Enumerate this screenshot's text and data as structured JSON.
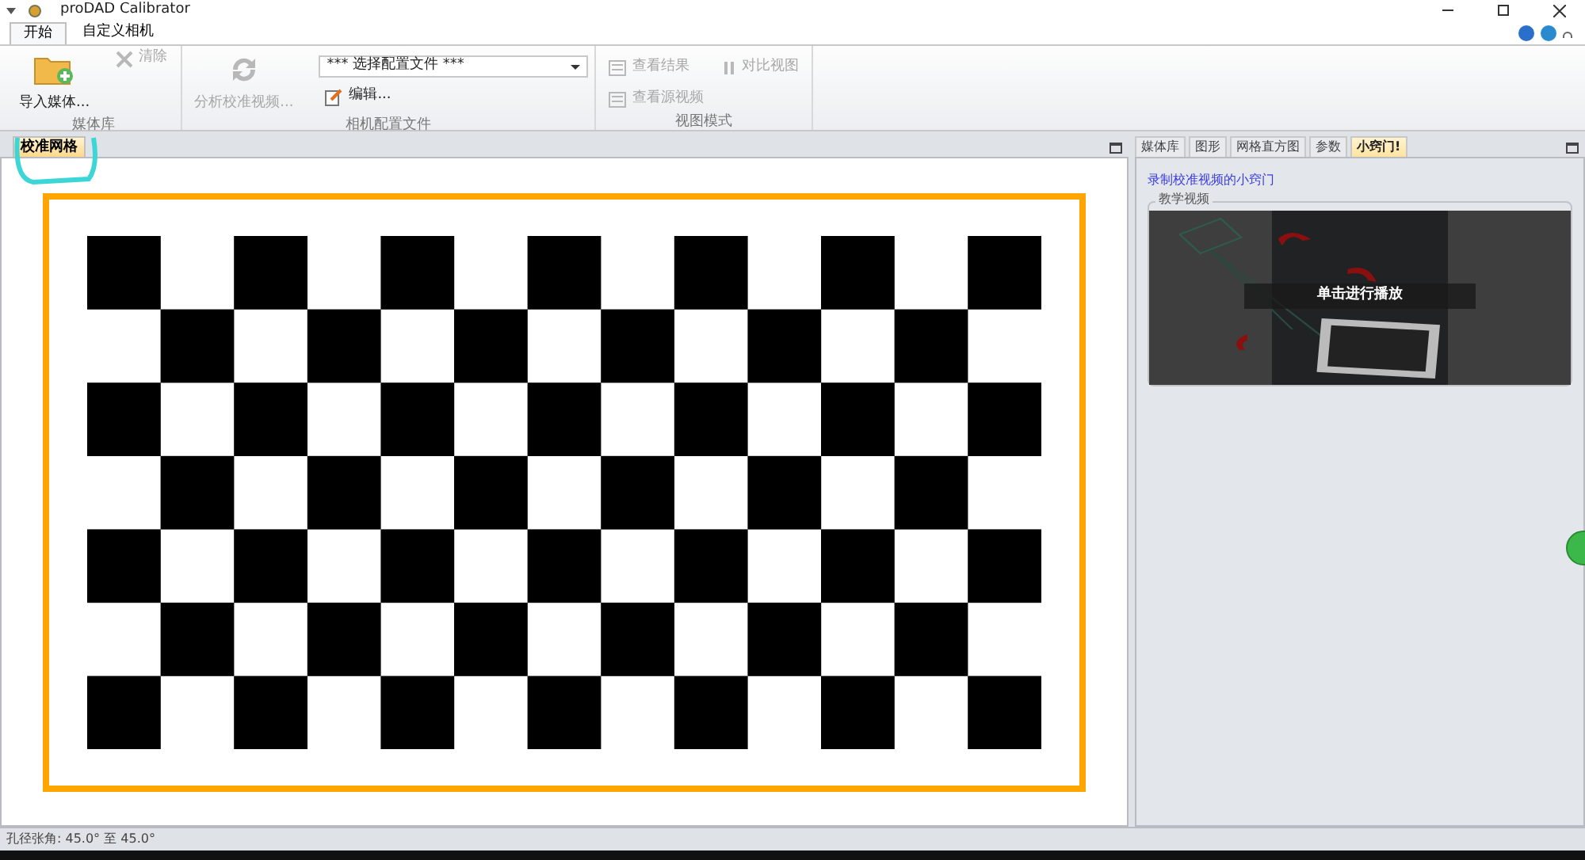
{
  "window": {
    "title": "proDAD Calibrator"
  },
  "ribbon_tabs": [
    {
      "label": "开始",
      "selected": true
    },
    {
      "label": "自定义相机",
      "selected": false
    }
  ],
  "ribbon_groups": [
    {
      "label": "媒体库",
      "items": [
        {
          "kind": "large",
          "label": "导入媒体...",
          "disabled": false
        },
        {
          "kind": "small",
          "label": "清除",
          "disabled": true
        }
      ]
    },
    {
      "label": "相机配置文件",
      "items": [
        {
          "kind": "large",
          "label": "分析校准视频...",
          "disabled": true
        },
        {
          "kind": "dropdown",
          "label": "*** 选择配置文件 ***",
          "disabled": false
        },
        {
          "kind": "small",
          "label": "编辑...",
          "disabled": false
        }
      ]
    },
    {
      "label": "视图模式",
      "items": [
        {
          "kind": "small",
          "label": "查看结果",
          "disabled": true
        },
        {
          "kind": "small",
          "label": "对比视图",
          "disabled": true
        },
        {
          "kind": "small",
          "label": "查看源视频",
          "disabled": true
        }
      ]
    }
  ],
  "left_panel": {
    "tabs": [
      {
        "label": "校准网格",
        "selected": true
      }
    ]
  },
  "right_panel": {
    "tabs": [
      {
        "label": "媒体库",
        "selected": false
      },
      {
        "label": "图形",
        "selected": false
      },
      {
        "label": "网格直方图",
        "selected": false
      },
      {
        "label": "参数",
        "selected": false
      },
      {
        "label": "小窍门!",
        "selected": true
      }
    ],
    "link": "录制校准视频的小窍门",
    "group_title": "教学视频",
    "video_caption": "单击进行播放"
  },
  "status_bar": "孔径张角: 45.0° 至 45.0°"
}
